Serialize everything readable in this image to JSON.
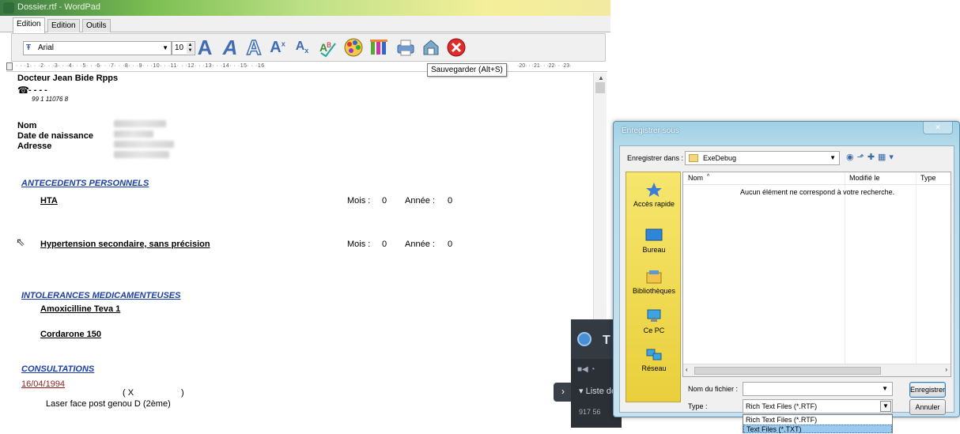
{
  "editor": {
    "window_title": "Dossier.rtf - WordPad",
    "tabs": [
      "Edition",
      "Edition",
      "Outils"
    ],
    "font_name": "Arial",
    "font_size": "10",
    "ruler_text": "· · ·1· · ·2· · ·3· · ·4· · ·5· · ·6· · ·7· · ·8· · ·9· · ·10· · ·11· · ·12· · ·13· · ·14· · ·15· · ·16",
    "ruler_tail": "·20· · ·21· · ·22· · ·23·",
    "tooltip": "Sauvegarder (Alt+S)",
    "toolbar_icons": [
      "font-grow-icon",
      "font-shrink-icon",
      "font-outline-icon",
      "superscript-icon",
      "subscript-icon",
      "spellcheck-icon",
      "palette-icon",
      "columns-icon",
      "print-icon",
      "save-icon",
      "close-icon"
    ]
  },
  "document": {
    "doctor": "Docteur Jean Bide Rpps",
    "phone_dashes": "- - - -",
    "rpps_number": "99 1 11076 8",
    "labels": {
      "name": "Nom",
      "birth": "Date de naissance",
      "address": "Adresse"
    },
    "sections": {
      "antecedents": "ANTECEDENTS PERSONNELS",
      "intolerances": "INTOLERANCES MEDICAMENTEUSES",
      "consultations": "CONSULTATIONS"
    },
    "antecedents": [
      {
        "name": "HTA",
        "mois_label": "Mois :",
        "mois": "0",
        "annee_label": "Année :",
        "annee": "0"
      },
      {
        "name": "Hypertension secondaire, sans précision",
        "mois_label": "Mois :",
        "mois": "0",
        "annee_label": "Année :",
        "annee": "0"
      }
    ],
    "intolerances": [
      "Amoxicilline Teva 1",
      "Cordarone 150"
    ],
    "consultation": {
      "date": "16/04/1994",
      "bracket_open": "( X",
      "bracket_close": ")",
      "text": "Laser face post genou D (2ème)"
    }
  },
  "dark_panel": {
    "title_letter": "T",
    "liste": "▾ Liste de",
    "number": "917 56"
  },
  "dialog": {
    "title": "Enregistrer sous",
    "save_in_label": "Enregistrer dans :",
    "save_in_value": "ExeDebug",
    "places": [
      "Accès rapide",
      "Bureau",
      "Bibliothèques",
      "Ce PC",
      "Réseau"
    ],
    "columns": [
      "Nom",
      "Modifié le",
      "Type"
    ],
    "empty_message": "Aucun élément ne correspond à votre recherche.",
    "filename_label": "Nom du fichier :",
    "filename_value": "",
    "type_label": "Type :",
    "type_value": "Rich Text Files (*.RTF)",
    "type_options": [
      "Rich Text Files (*.RTF)",
      "Text Files (*.TXT)"
    ],
    "save_button": "Enregistrer",
    "cancel_button": "Annuler"
  }
}
